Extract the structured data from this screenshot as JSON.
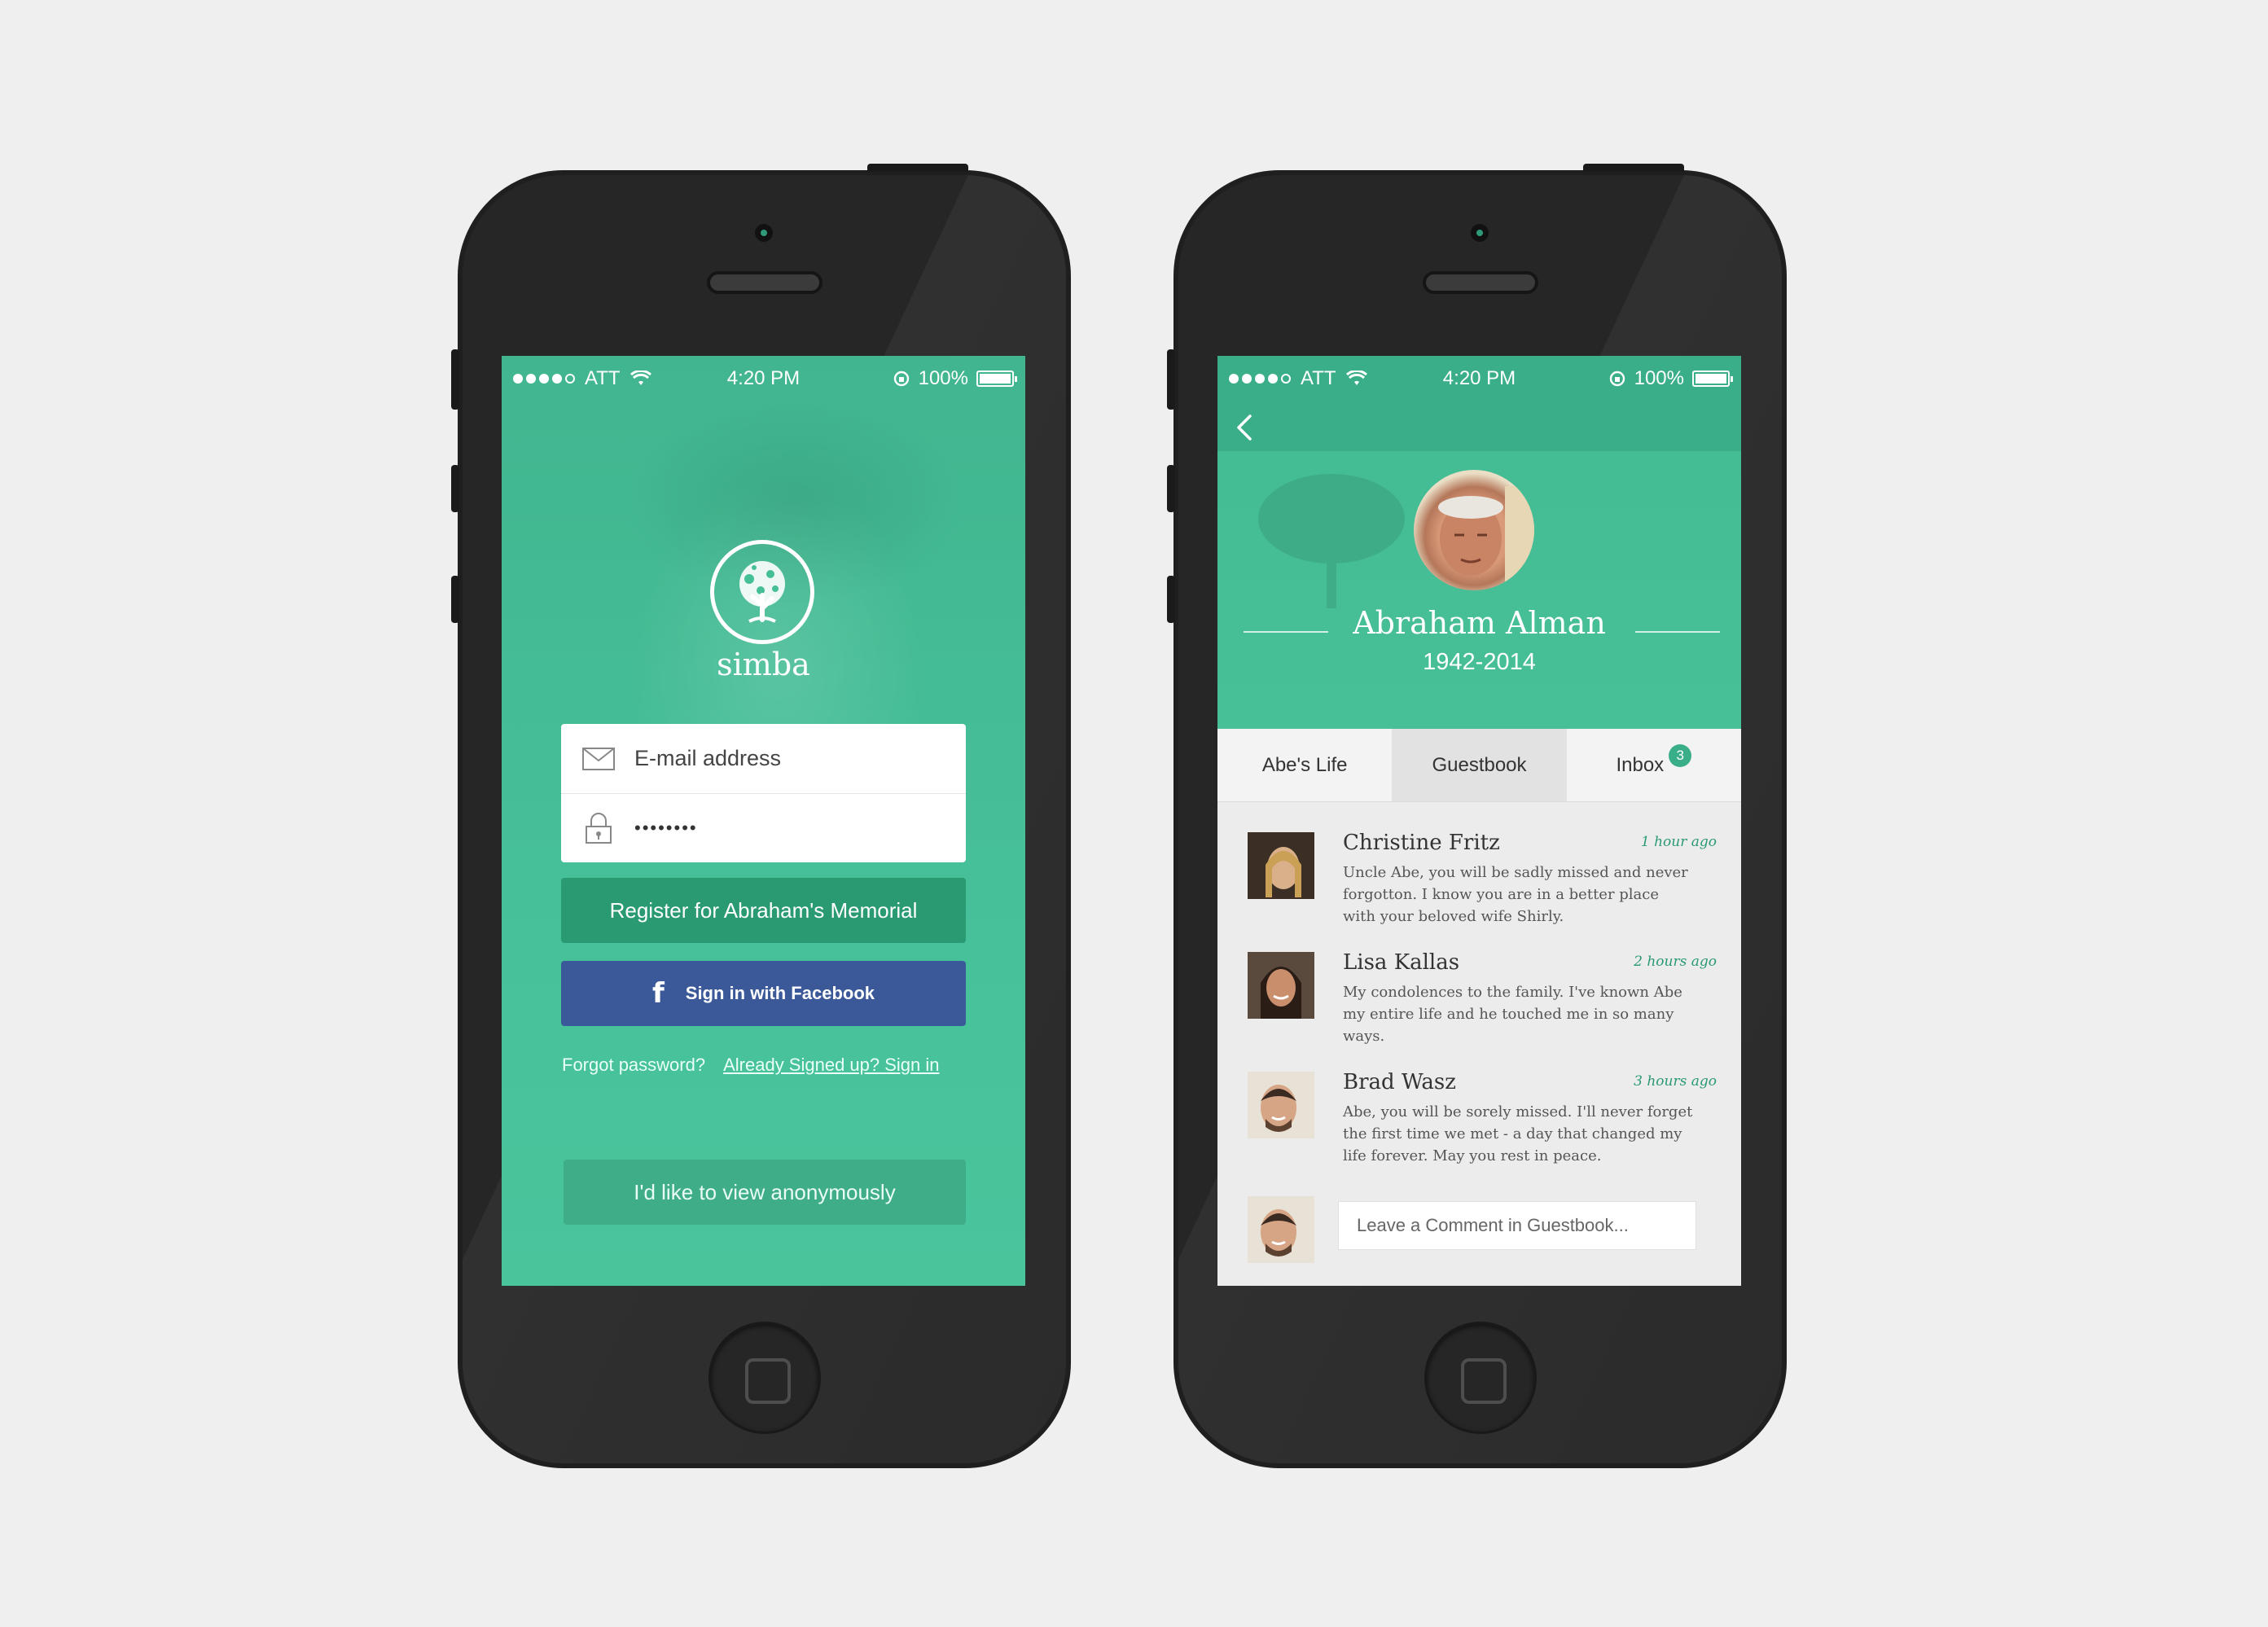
{
  "status_bar": {
    "carrier": "ATT",
    "time": "4:20 PM",
    "battery": "100%"
  },
  "login_screen": {
    "brand": "simba",
    "email_placeholder": "E-mail address",
    "password_value": "••••••••",
    "register_label": "Register for Abraham's Memorial",
    "facebook_label": "Sign in with Facebook",
    "facebook_glyph": "f",
    "forgot_label": "Forgot password?",
    "signin_label": "Already Signed up? Sign in",
    "anonymous_label": "I'd like to view anonymously"
  },
  "profile_screen": {
    "name": "Abraham Alman",
    "years": "1942-2014",
    "tabs": [
      {
        "label": "Abe's Life",
        "active": false
      },
      {
        "label": "Guestbook",
        "active": true
      },
      {
        "label": "Inbox",
        "badge": "3",
        "active": false
      }
    ],
    "comments": [
      {
        "author": "Christine Fritz",
        "time": "1 hour ago",
        "text": "Uncle Abe, you will be sadly missed and never forgotton.  I know you are in a better place with your beloved wife Shirly."
      },
      {
        "author": "Lisa Kallas",
        "time": "2 hours ago",
        "text": "My condolences to the family. I've known Abe my entire life and he touched me in so many ways."
      },
      {
        "author": "Brad Wasz",
        "time": "3 hours ago",
        "text": "Abe, you will be sorely missed. I'll never forget the first time we met - a day that changed my life forever. May you rest in peace."
      }
    ],
    "comment_placeholder": "Leave a Comment in Guestbook..."
  },
  "colors": {
    "accent_green": "#45bf96",
    "dark_green": "#2a9a73",
    "facebook_blue": "#3b5998",
    "background": "#efefef",
    "phone_body": "#1f1f1f"
  }
}
